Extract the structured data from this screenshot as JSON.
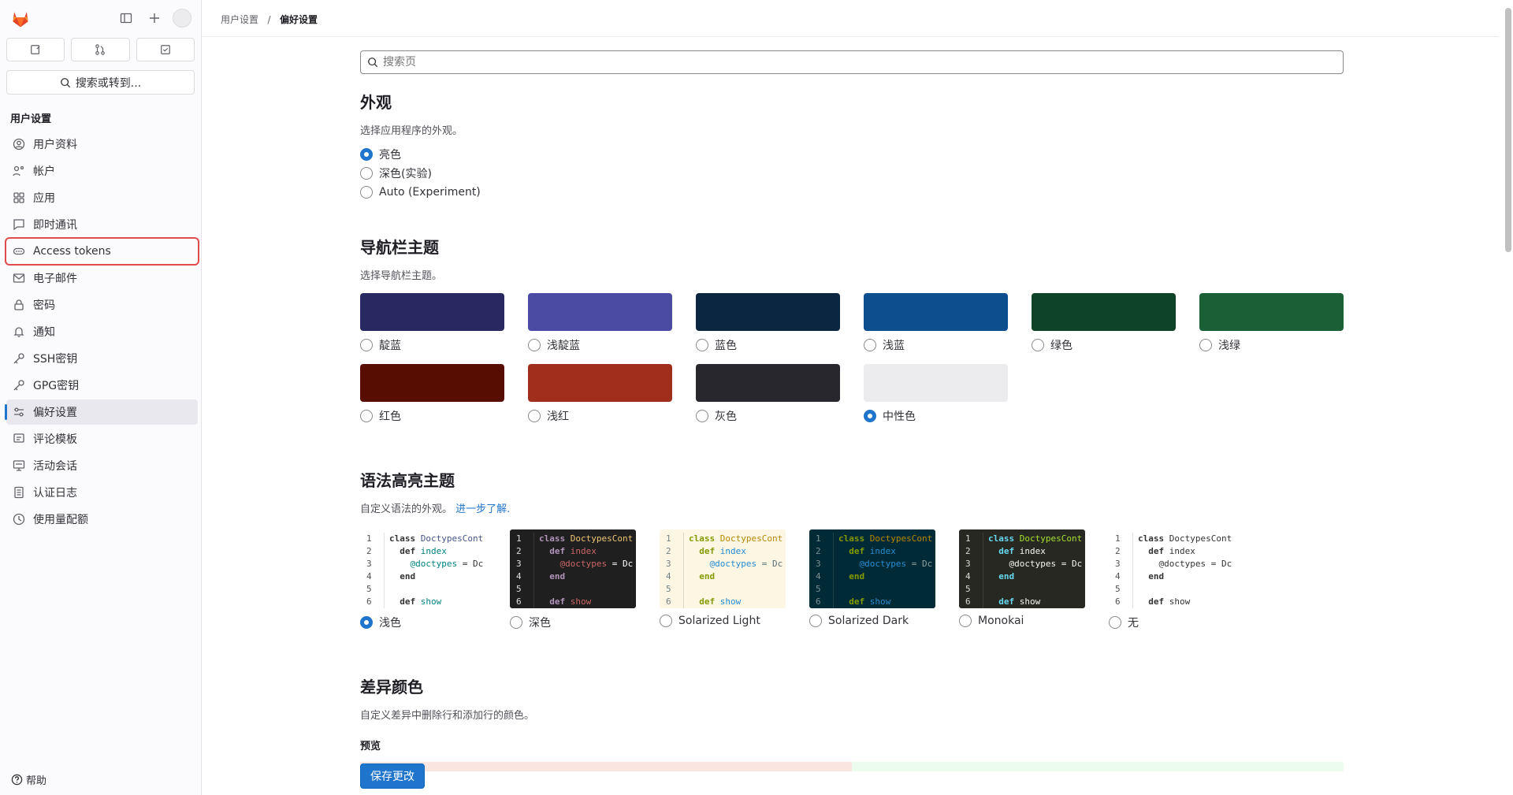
{
  "breadcrumb": [
    "用户设置",
    "偏好设置"
  ],
  "sidebar": {
    "search_label": "搜索或转到...",
    "section_title": "用户设置",
    "items": [
      {
        "label": "用户资料",
        "icon": "profile-icon"
      },
      {
        "label": "帐户",
        "icon": "account-icon"
      },
      {
        "label": "应用",
        "icon": "applications-icon"
      },
      {
        "label": "即时通讯",
        "icon": "chat-icon"
      },
      {
        "label": "Access tokens",
        "icon": "token-icon"
      },
      {
        "label": "电子邮件",
        "icon": "mail-icon"
      },
      {
        "label": "密码",
        "icon": "lock-icon"
      },
      {
        "label": "通知",
        "icon": "bell-icon"
      },
      {
        "label": "SSH密钥",
        "icon": "key-icon"
      },
      {
        "label": "GPG密钥",
        "icon": "key-icon"
      },
      {
        "label": "偏好设置",
        "icon": "preferences-icon"
      },
      {
        "label": "评论模板",
        "icon": "comment-icon"
      },
      {
        "label": "活动会话",
        "icon": "session-icon"
      },
      {
        "label": "认证日志",
        "icon": "log-icon"
      },
      {
        "label": "使用量配额",
        "icon": "quota-icon"
      }
    ],
    "help_label": "帮助"
  },
  "main": {
    "search_placeholder": "搜索页",
    "appearance": {
      "title": "外观",
      "desc": "选择应用程序的外观。",
      "options": [
        "亮色",
        "深色(实验)",
        "Auto (Experiment)"
      ],
      "selected": 0
    },
    "navbar": {
      "title": "导航栏主题",
      "desc": "选择导航栏主题。",
      "themes": [
        {
          "label": "靛蓝",
          "color": "#292961"
        },
        {
          "label": "浅靛蓝",
          "color": "#4b4ba3"
        },
        {
          "label": "蓝色",
          "color": "#0b2640"
        },
        {
          "label": "浅蓝",
          "color": "#0d4f8e"
        },
        {
          "label": "绿色",
          "color": "#0e4328"
        },
        {
          "label": "浅绿",
          "color": "#1b5f37"
        },
        {
          "label": "红色",
          "color": "#580d02"
        },
        {
          "label": "浅红",
          "color": "#a02e1c"
        },
        {
          "label": "灰色",
          "color": "#28272d"
        },
        {
          "label": "中性色",
          "color": "#ececef"
        }
      ],
      "selected": 9
    },
    "syntax": {
      "title": "语法高亮主题",
      "desc": "自定义语法的外观。",
      "link": "进一步了解.",
      "themes": [
        {
          "label": "浅色",
          "bg": "#ffffff",
          "fg": "#333333",
          "kw": "#333333",
          "cls": "#445588",
          "var": "#008080"
        },
        {
          "label": "深色",
          "bg": "#1f1f1f",
          "fg": "#ffffff",
          "kw": "#b294bb",
          "cls": "#f0c674",
          "var": "#cc6666"
        },
        {
          "label": "Solarized Light",
          "bg": "#fdf6e3",
          "fg": "#586e75",
          "kw": "#859900",
          "cls": "#b58900",
          "var": "#268bd2"
        },
        {
          "label": "Solarized Dark",
          "bg": "#002b36",
          "fg": "#93a1a1",
          "kw": "#859900",
          "cls": "#b58900",
          "var": "#268bd2"
        },
        {
          "label": "Monokai",
          "bg": "#272822",
          "fg": "#f8f8f2",
          "kw": "#66d9ef",
          "cls": "#a6e22e",
          "var": "#f8f8f2"
        },
        {
          "label": "无",
          "bg": "#ffffff",
          "fg": "#333333",
          "kw": "#333333",
          "cls": "#333333",
          "var": "#333333"
        }
      ],
      "selected": 0,
      "code_lines": [
        "class DoctypesCont",
        "  def index",
        "    @doctypes = Dc",
        "  end",
        "",
        "  def show"
      ]
    },
    "diff": {
      "title": "差异颜色",
      "desc": "自定义差异中删除行和添加行的颜色。",
      "preview_label": "预览"
    },
    "save_label": "保存更改"
  }
}
